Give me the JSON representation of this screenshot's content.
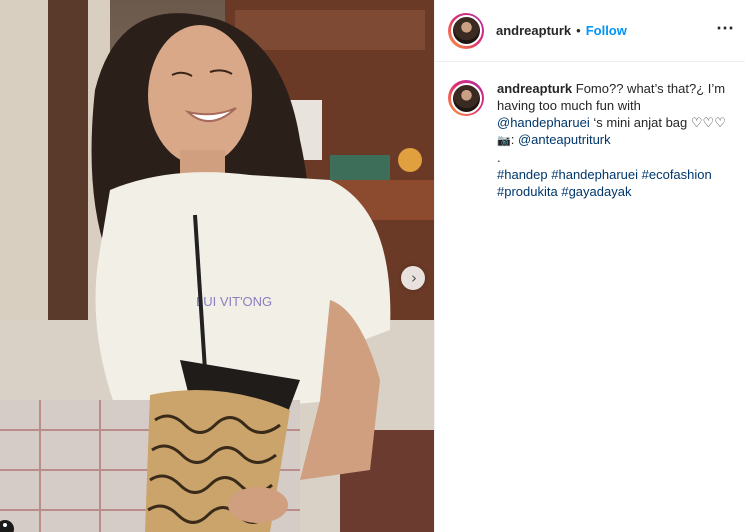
{
  "post": {
    "author": "andreapturk",
    "separator": "•",
    "follow_label": "Follow",
    "more_icon": "more-horizontal-icon",
    "carousel_next_icon": "chevron-right-icon"
  },
  "caption": {
    "author": "andreapturk",
    "text_1": " Fomo?? what’s that?¿ I’m having too much fun with",
    "mention_1": "@handepharuei",
    "text_2": " ‘s mini anjat bag ♡♡♡",
    "camera_glyph": "📷",
    "text_3": ": ",
    "mention_2": "@anteaputriturk",
    "dot": ".",
    "hashtags": [
      "#handep",
      "#handepharuei",
      "#ecofashion",
      "#produkita",
      "#gayadayak"
    ]
  },
  "colors": {
    "follow": "#0095f6",
    "link": "#00376b",
    "text": "#262626"
  }
}
